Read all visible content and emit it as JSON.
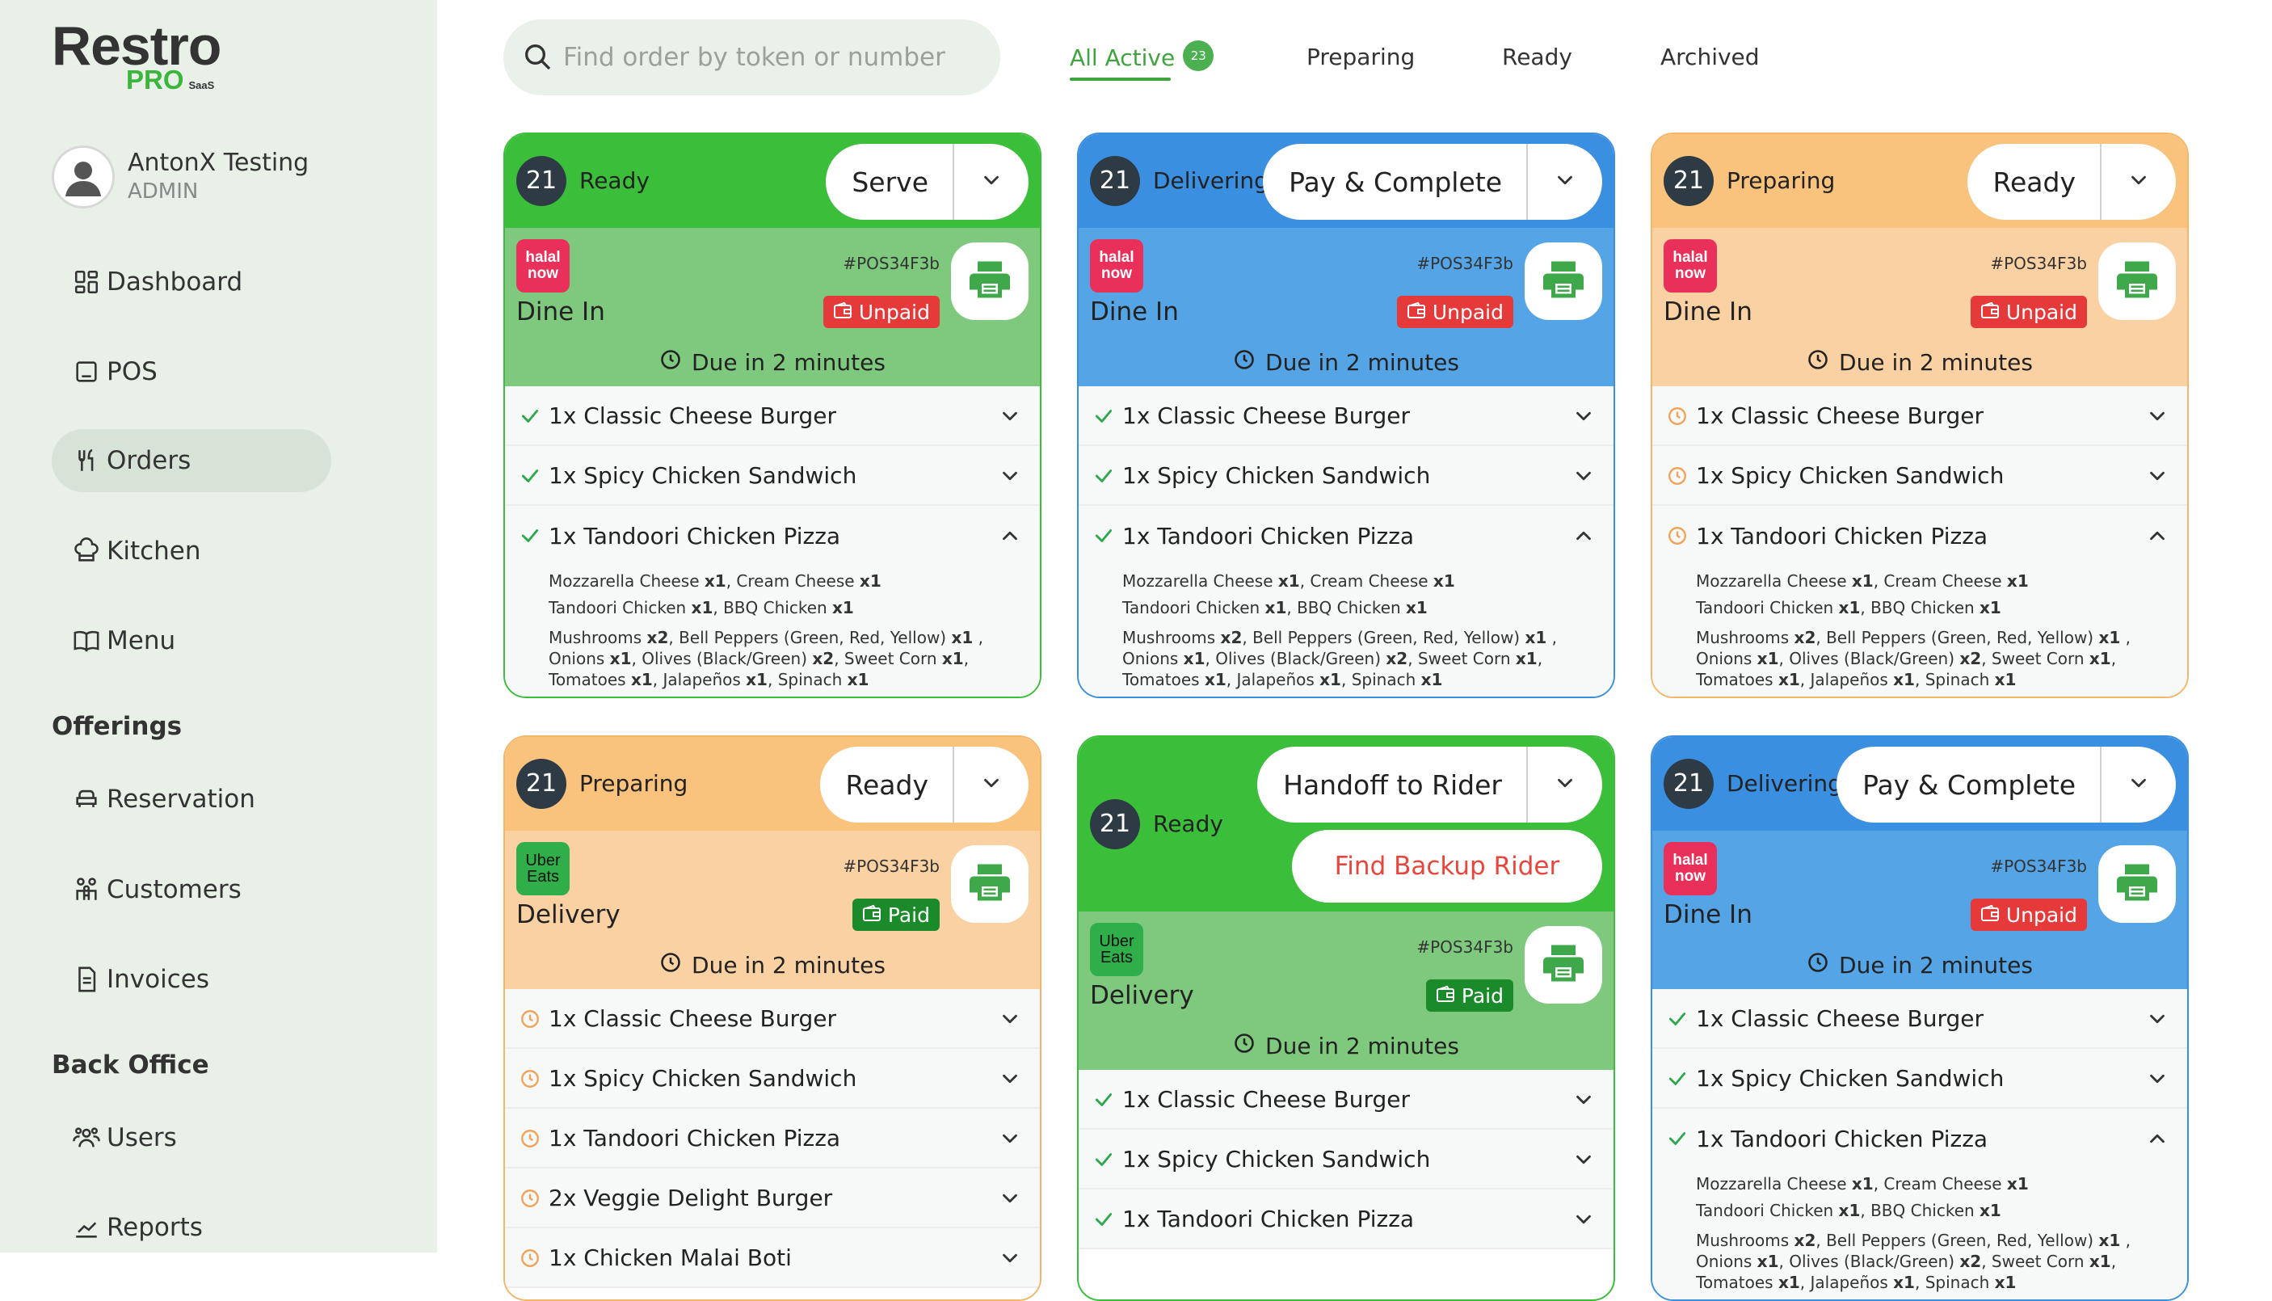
{
  "app": {
    "logo": "Restro",
    "logo_sub": "PRO",
    "logo_tag": "SaaS"
  },
  "user": {
    "name": "AntonX Testing",
    "role": "ADMIN"
  },
  "nav": {
    "main": [
      {
        "label": "Dashboard",
        "icon": "dashboard-icon"
      },
      {
        "label": "POS",
        "icon": "pos-icon"
      },
      {
        "label": "Orders",
        "icon": "orders-icon",
        "active": true
      },
      {
        "label": "Kitchen",
        "icon": "kitchen-icon"
      },
      {
        "label": "Menu",
        "icon": "menu-icon"
      }
    ],
    "offerings_title": "Offerings",
    "offerings": [
      {
        "label": "Reservation",
        "icon": "reservation-icon"
      },
      {
        "label": "Customers",
        "icon": "customers-icon"
      },
      {
        "label": "Invoices",
        "icon": "invoices-icon"
      }
    ],
    "backoffice_title": "Back Office",
    "backoffice": [
      {
        "label": "Users",
        "icon": "users-icon"
      },
      {
        "label": "Reports",
        "icon": "reports-icon"
      }
    ]
  },
  "search": {
    "placeholder": "Find order by token or number",
    "value": ""
  },
  "tabs": [
    {
      "label": "All Active",
      "count": "23",
      "active": true
    },
    {
      "label": "Preparing"
    },
    {
      "label": "Ready"
    },
    {
      "label": "Archived"
    }
  ],
  "colors": {
    "green": "#3bbf3b",
    "blue": "#3a8fe0",
    "orange": "#f9c27d",
    "unpaid": "#e5393a",
    "paid": "#1b8a2a"
  },
  "modifiers": {
    "line1": [
      [
        "Mozzarella Cheese ",
        "x1"
      ],
      [
        ", Cream Cheese ",
        "x1"
      ]
    ],
    "line2": [
      [
        "Tandoori Chicken ",
        "x1"
      ],
      [
        ", BBQ Chicken ",
        "x1"
      ]
    ],
    "line3": [
      [
        "Mushrooms ",
        "x2"
      ],
      [
        ", Bell Peppers (Green, Red, Yellow) ",
        "x1"
      ],
      [
        " ,",
        ""
      ]
    ],
    "line4": [
      [
        "Onions ",
        "x1"
      ],
      [
        ", Olives (Black/Green) ",
        "x2"
      ],
      [
        ", Sweet Corn ",
        "x1"
      ],
      [
        ",",
        ""
      ]
    ],
    "line5": [
      [
        "Tomatoes ",
        "x1"
      ],
      [
        ", Jalapeños ",
        "x1"
      ],
      [
        ", Spinach ",
        "x1"
      ]
    ]
  },
  "cards": [
    {
      "token": "21",
      "status": "Ready",
      "color": "green",
      "action": "Serve",
      "platform": "halal",
      "platform_label": [
        "halal",
        "now"
      ],
      "order_type": "Dine In",
      "order_no": "#POS34F3b",
      "payment": "Unpaid",
      "due": "Due in 2 minutes",
      "items": [
        {
          "text": "1x Classic Cheese Burger",
          "state": "done"
        },
        {
          "text": "1x Spicy Chicken Sandwich",
          "state": "done"
        },
        {
          "text": "1x Tandoori Chicken Pizza",
          "state": "done",
          "expanded": true
        }
      ]
    },
    {
      "token": "21",
      "status": "Delivering",
      "color": "blue",
      "action": "Pay & Complete",
      "platform": "halal",
      "platform_label": [
        "halal",
        "now"
      ],
      "order_type": "Dine In",
      "order_no": "#POS34F3b",
      "payment": "Unpaid",
      "due": "Due in 2 minutes",
      "items": [
        {
          "text": "1x Classic Cheese Burger",
          "state": "done"
        },
        {
          "text": "1x Spicy Chicken Sandwich",
          "state": "done"
        },
        {
          "text": "1x Tandoori Chicken Pizza",
          "state": "done",
          "expanded": true
        }
      ]
    },
    {
      "token": "21",
      "status": "Preparing",
      "color": "orange",
      "action": "Ready",
      "platform": "halal",
      "platform_label": [
        "halal",
        "now"
      ],
      "order_type": "Dine In",
      "order_no": "#POS34F3b",
      "payment": "Unpaid",
      "due": "Due in 2 minutes",
      "items": [
        {
          "text": "1x Classic Cheese Burger",
          "state": "pending"
        },
        {
          "text": "1x Spicy Chicken Sandwich",
          "state": "pending"
        },
        {
          "text": "1x Tandoori Chicken Pizza",
          "state": "pending",
          "expanded": true
        }
      ]
    },
    {
      "token": "21",
      "status": "Preparing",
      "color": "orange",
      "action": "Ready",
      "platform": "uber",
      "platform_label": [
        "Uber",
        "Eats"
      ],
      "order_type": "Delivery",
      "order_no": "#POS34F3b",
      "payment": "Paid",
      "due": "Due in 2 minutes",
      "items": [
        {
          "text": "1x Classic Cheese Burger",
          "state": "pending"
        },
        {
          "text": "1x Spicy Chicken Sandwich",
          "state": "pending"
        },
        {
          "text": "1x Tandoori Chicken Pizza",
          "state": "pending"
        },
        {
          "text": "2x Veggie Delight Burger",
          "state": "pending"
        },
        {
          "text": "1x Chicken Malai Boti",
          "state": "pending"
        }
      ]
    },
    {
      "token": "21",
      "status": "Ready",
      "color": "green",
      "action": "Handoff to Rider",
      "secondary_action": "Find Backup Rider",
      "platform": "uber",
      "platform_label": [
        "Uber",
        "Eats"
      ],
      "order_type": "Delivery",
      "order_no": "#POS34F3b",
      "payment": "Paid",
      "due": "Due in 2 minutes",
      "items": [
        {
          "text": "1x Classic Cheese Burger",
          "state": "done"
        },
        {
          "text": "1x Spicy Chicken Sandwich",
          "state": "done"
        },
        {
          "text": "1x Tandoori Chicken Pizza",
          "state": "done"
        }
      ]
    },
    {
      "token": "21",
      "status": "Delivering",
      "color": "blue",
      "action": "Pay & Complete",
      "platform": "halal",
      "platform_label": [
        "halal",
        "now"
      ],
      "order_type": "Dine In",
      "order_no": "#POS34F3b",
      "payment": "Unpaid",
      "due": "Due in 2 minutes",
      "items": [
        {
          "text": "1x Classic Cheese Burger",
          "state": "done"
        },
        {
          "text": "1x Spicy Chicken Sandwich",
          "state": "done"
        },
        {
          "text": "1x Tandoori Chicken Pizza",
          "state": "done",
          "expanded": true
        }
      ]
    }
  ]
}
